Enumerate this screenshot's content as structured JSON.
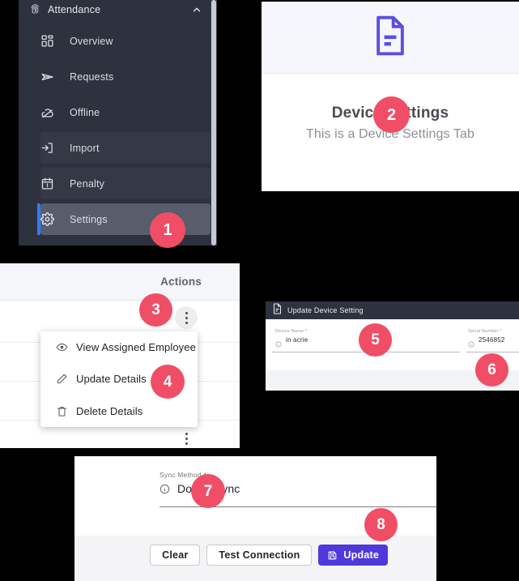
{
  "colors": {
    "badge": "#F04E66",
    "sidebar_bg": "#2E313E",
    "sidebar_active": "#585C6B",
    "active_indicator": "#2F7DF6",
    "accent_indigo": "#4F39DB",
    "doc_icon": "#5B4FE0"
  },
  "sidebar": {
    "group": {
      "label": "Attendance",
      "icon": "fingerprint-icon",
      "collapse_icon": "chevron-up-icon",
      "expanded": true
    },
    "items": [
      {
        "label": "Overview",
        "icon": "dashboard-grid-icon",
        "state": "normal"
      },
      {
        "label": "Requests",
        "icon": "send-paper-plane-icon",
        "state": "normal"
      },
      {
        "label": "Offline",
        "icon": "cloud-off-icon",
        "state": "normal"
      },
      {
        "label": "Import",
        "icon": "import-arrow-icon",
        "state": "alt"
      },
      {
        "label": "Penalty",
        "icon": "calendar-alert-icon",
        "state": "alt"
      },
      {
        "label": "Settings",
        "icon": "gear-icon",
        "state": "active"
      }
    ]
  },
  "device_card": {
    "icon": "document-lines-icon",
    "title": "Device Settings",
    "subtitle": "This is a Device Settings Tab"
  },
  "table": {
    "header": {
      "actions": "Actions"
    },
    "row_menu_icon": "kebab-vertical-icon"
  },
  "context_menu": {
    "items": [
      {
        "label": "View Assigned Employee",
        "icon": "eye-icon"
      },
      {
        "label": "Update Details",
        "icon": "pencil-icon"
      },
      {
        "label": "Delete Details",
        "icon": "trash-icon"
      }
    ]
  },
  "update_dialog": {
    "icon": "document-lines-icon",
    "title": "Update Device Setting",
    "fields": [
      {
        "label": "Device Name *",
        "value": "in acrie",
        "icon": "info-circle-icon"
      },
      {
        "label": "Serial Number *",
        "value": "2546852",
        "icon": "info-circle-icon"
      }
    ]
  },
  "sync_panel": {
    "field": {
      "label": "Sync Method *",
      "value": "Do not Sync",
      "icon": "info-circle-icon",
      "dropdown_icon": "caret-down-icon"
    },
    "buttons": [
      {
        "label": "Clear",
        "style": "outline",
        "icon": null
      },
      {
        "label": "Test Connection",
        "style": "outline",
        "icon": null
      },
      {
        "label": "Update",
        "style": "primary",
        "icon": "save-disk-icon"
      }
    ]
  },
  "step_badges": [
    {
      "number": "1"
    },
    {
      "number": "2"
    },
    {
      "number": "3"
    },
    {
      "number": "4"
    },
    {
      "number": "5"
    },
    {
      "number": "6"
    },
    {
      "number": "7"
    },
    {
      "number": "8"
    }
  ]
}
